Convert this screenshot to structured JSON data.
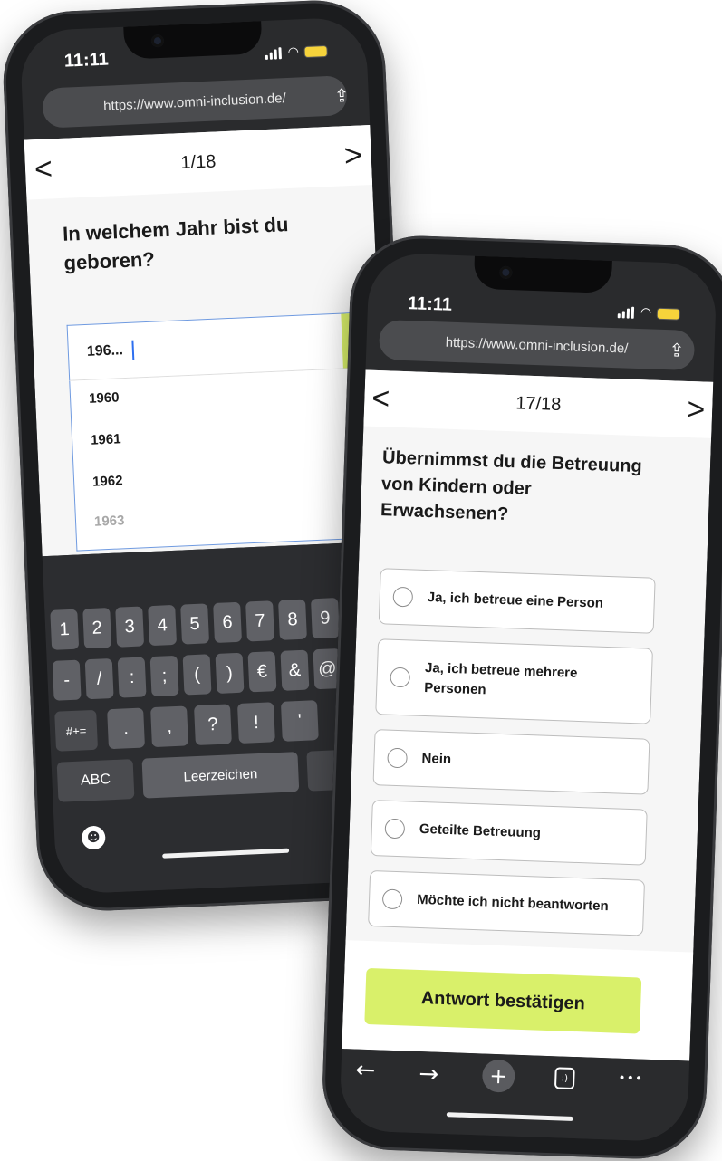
{
  "colors": {
    "accent": "#d9f06a",
    "frame": "#1b1c1e",
    "keyboard": "#2c2d30"
  },
  "back_phone": {
    "status": {
      "time": "11:11"
    },
    "browser": {
      "url": "https://www.omni-inclusion.de/",
      "share_icon": "share-icon"
    },
    "nav": {
      "prev": "<",
      "counter": "1/18",
      "next": ">"
    },
    "question": "In welchem Jahr bist du geboren?",
    "input": {
      "value": "196..."
    },
    "dropdown": [
      "1960",
      "1961",
      "1962",
      "1963"
    ],
    "keyboard": {
      "row1": [
        "1",
        "2",
        "3",
        "4",
        "5",
        "6",
        "7",
        "8",
        "9"
      ],
      "row2": [
        "-",
        "/",
        ":",
        ";",
        "(",
        ")",
        "€",
        "&",
        "@"
      ],
      "row3": [
        ".",
        ",",
        "?",
        "!",
        "'"
      ],
      "shift_label": "#+=",
      "abc_label": "ABC",
      "space_label": "Leerzeichen",
      "emoji_icon": "emoji-icon"
    }
  },
  "front_phone": {
    "status": {
      "time": "11:11"
    },
    "browser": {
      "url": "https://www.omni-inclusion.de/",
      "share_icon": "share-icon"
    },
    "nav": {
      "prev": "<",
      "counter": "17/18",
      "next": ">"
    },
    "question": "Übernimmst du die Betreuung von Kindern oder Erwachsenen?",
    "options": [
      "Ja, ich betreue eine Person",
      "Ja, ich betreue mehrere Personen",
      "Nein",
      "Geteilte Betreuung",
      "Möchte ich nicht beantworten"
    ],
    "submit_label": "Antwort bestätigen",
    "toolbar": {
      "back": "←",
      "forward": "→",
      "new_tab": "+",
      "tabs": ":)",
      "more": "•••"
    }
  }
}
